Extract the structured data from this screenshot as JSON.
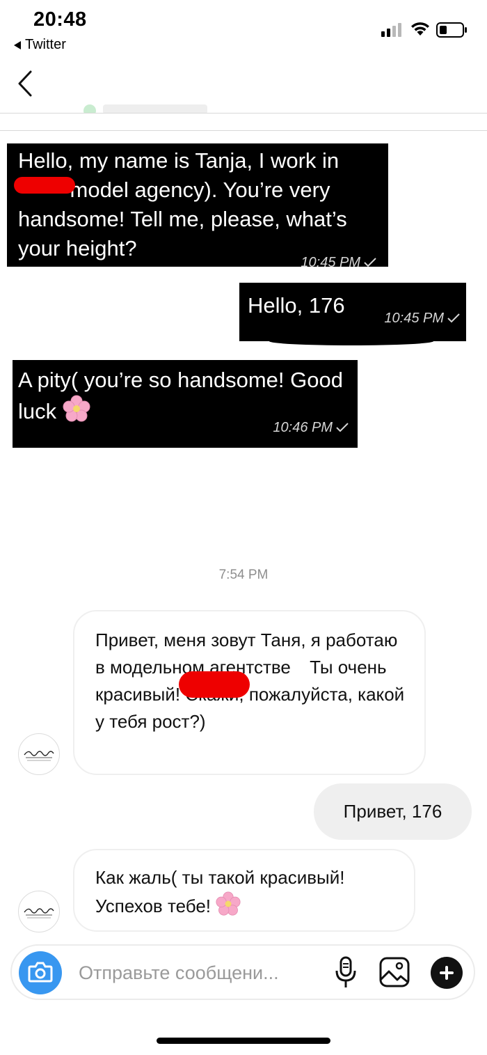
{
  "status_bar": {
    "time": "20:48",
    "back_app": "Twitter"
  },
  "screenshot_messages": [
    {
      "sender": "incoming",
      "text": "Hello, my name is Tanja, I work in ▬▬ model agency). You’re very handsome! Tell me, please, what’s your height?",
      "time": "10:45 PM"
    },
    {
      "sender": "outgoing",
      "text": "Hello, 176",
      "time": "10:45 PM"
    },
    {
      "sender": "incoming",
      "text": "A pity( you’re so handsome! Good luck",
      "time": "10:46 PM"
    }
  ],
  "separator_time": "7:54 PM",
  "chat": [
    {
      "sender": "incoming",
      "text": "Привет, меня зовут Таня, я работаю в модельном агентстве Ты очень красивый! Скажи, пожалуйста, какой у тебя рост?)"
    },
    {
      "sender": "outgoing",
      "text": "Привет, 176"
    },
    {
      "sender": "incoming",
      "text": "Как жаль( ты такой красивый! Успехов тебе!"
    }
  ],
  "composer": {
    "placeholder": "Отправьте сообщени..."
  },
  "icons": {
    "back": "chevron-left-icon",
    "camera": "camera-icon",
    "mic": "microphone-icon",
    "gallery": "image-icon",
    "plus": "plus-icon",
    "emoji": "cherry-blossom-icon"
  },
  "colors": {
    "camera_button": "#3897f0",
    "redaction": "#e00000",
    "bubble_outgoing": "#efefef"
  }
}
